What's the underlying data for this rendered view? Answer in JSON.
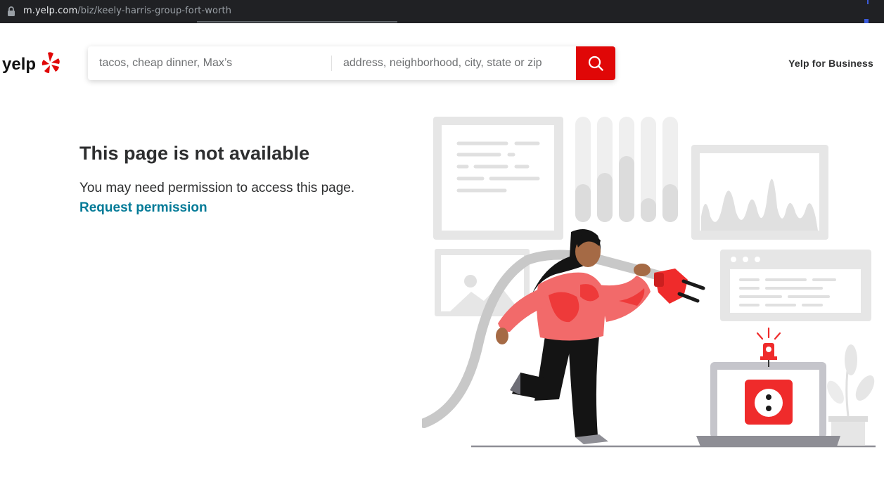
{
  "browser": {
    "url_host": "m.yelp.com",
    "url_path": "/biz/keely-harris-group-fort-worth"
  },
  "header": {
    "logo_text": "yelp",
    "search": {
      "find_placeholder": "tacos, cheap dinner, Max’s",
      "near_placeholder": "address, neighborhood, city, state or zip",
      "search_icon": "search-icon"
    },
    "business_link": "Yelp for Business"
  },
  "main": {
    "title": "This page is not available",
    "message": "You may need permission to access this page.",
    "request_link": "Request permission"
  },
  "colors": {
    "brand_red": "#e00707",
    "link_teal": "#027a97",
    "text_dark": "#2d2e2f",
    "illustration_gray": "#e6e6e6"
  }
}
